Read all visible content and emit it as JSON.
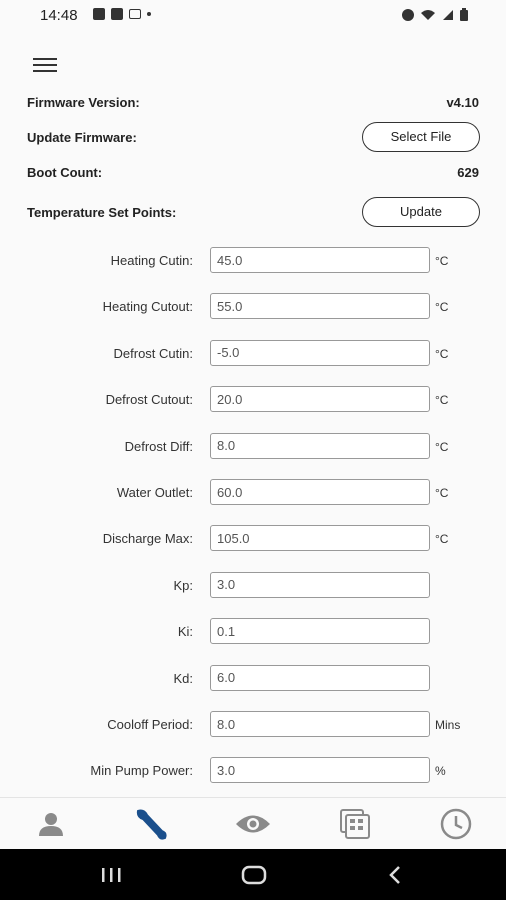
{
  "status": {
    "time": "14:48",
    "icons": [
      "image-icon",
      "teams-icon",
      "mail-icon",
      "dot-icon",
      "alarm-icon",
      "wifi-icon",
      "signal-icon",
      "battery-icon"
    ]
  },
  "header": {
    "menu_icon": "hamburger-menu-icon"
  },
  "firmware": {
    "label": "Firmware Version:",
    "value": "v4.10"
  },
  "update_firmware": {
    "label": "Update Firmware:",
    "button": "Select File"
  },
  "boot_count": {
    "label": "Boot Count:",
    "value": "629"
  },
  "set_points": {
    "label": "Temperature Set Points:",
    "button": "Update"
  },
  "params": [
    {
      "label": "Heating Cutin:",
      "value": "45.0",
      "unit": "°C"
    },
    {
      "label": "Heating Cutout:",
      "value": "55.0",
      "unit": "°C"
    },
    {
      "label": "Defrost Cutin:",
      "value": "-5.0",
      "unit": "°C"
    },
    {
      "label": "Defrost Cutout:",
      "value": "20.0",
      "unit": "°C"
    },
    {
      "label": "Defrost Diff:",
      "value": "8.0",
      "unit": "°C"
    },
    {
      "label": "Water Outlet:",
      "value": "60.0",
      "unit": "°C"
    },
    {
      "label": "Discharge Max:",
      "value": "105.0",
      "unit": "°C"
    },
    {
      "label": "Kp:",
      "value": "3.0",
      "unit": ""
    },
    {
      "label": "Ki:",
      "value": "0.1",
      "unit": ""
    },
    {
      "label": "Kd:",
      "value": "6.0",
      "unit": ""
    },
    {
      "label": "Cooloff Period:",
      "value": "8.0",
      "unit": "Mins"
    },
    {
      "label": "Min Pump Power:",
      "value": "3.0",
      "unit": "%"
    }
  ],
  "bottom_nav": {
    "items": [
      "person-icon",
      "wrench-icon",
      "eye-icon",
      "calculator-icon",
      "clock-icon"
    ],
    "active": "wrench-icon",
    "colors": {
      "active": "#1a4f8c",
      "inactive": "#8a8a8a"
    }
  },
  "system_nav": [
    "recents-icon",
    "home-icon",
    "back-icon"
  ]
}
